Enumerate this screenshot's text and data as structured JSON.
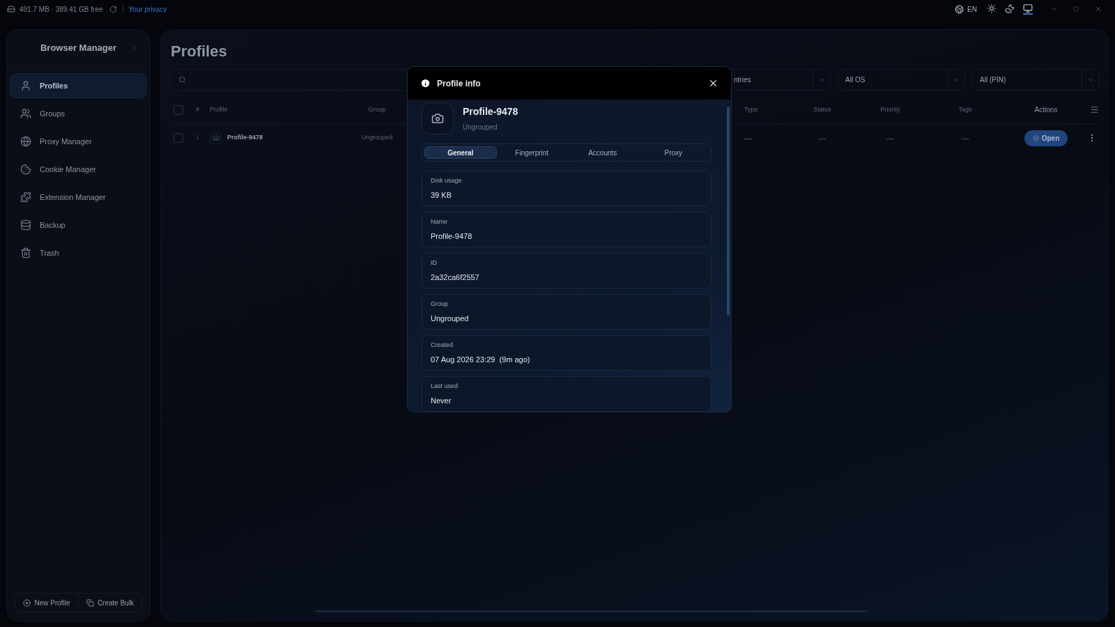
{
  "top_bar": {
    "storage": "491.7 MB · 389.41 GB free",
    "privacy_link": "Your privacy",
    "language": "EN",
    "themes": [
      {
        "kind": "light",
        "selected": false
      },
      {
        "kind": "dark",
        "selected": false
      },
      {
        "kind": "system",
        "selected": true
      }
    ]
  },
  "sidebar": {
    "title": "Browser Manager",
    "items": [
      {
        "label": "Profiles",
        "kind": "user",
        "selected": true
      },
      {
        "label": "Groups",
        "kind": "users",
        "selected": false
      },
      {
        "label": "Proxy Manager",
        "kind": "globe",
        "selected": false
      },
      {
        "label": "Cookie Manager",
        "kind": "cookie",
        "selected": false
      },
      {
        "label": "Extension Manager",
        "kind": "extension",
        "selected": false
      },
      {
        "label": "Backup",
        "kind": "database",
        "selected": false
      },
      {
        "label": "Trash",
        "kind": "trash",
        "selected": false
      }
    ],
    "buttons": [
      {
        "label": "New Profile",
        "kind": "plus"
      },
      {
        "label": "Create Bulk",
        "kind": "bulk"
      }
    ]
  },
  "main": {
    "title": "Profiles",
    "filters": [
      {
        "value": "ntries"
      },
      {
        "value": "All OS"
      },
      {
        "value": "All (PIN)"
      }
    ],
    "table": {
      "header_checked": false,
      "columns": [
        "#",
        "Profile",
        "Group",
        "Type",
        "Status",
        "Priority",
        "Tags",
        "Actions"
      ],
      "rows": [
        {
          "index": "1",
          "profile": "Profile-9478",
          "group": "Ungrouped",
          "type": "—",
          "status": "—",
          "priority": "—",
          "tags": "—",
          "action": "Open",
          "checked": false
        }
      ]
    }
  },
  "dialog": {
    "title": "Profile info",
    "profile_name": "Profile-9478",
    "profile_group": "Ungrouped",
    "tabs": [
      {
        "label": "General",
        "selected": true
      },
      {
        "label": "Fingerprint",
        "selected": false
      },
      {
        "label": "Accounts",
        "selected": false
      },
      {
        "label": "Proxy",
        "selected": false
      }
    ],
    "fields": [
      {
        "label": "Disk usage",
        "value": "39 KB"
      },
      {
        "label": "Name",
        "value": "Profile-9478"
      },
      {
        "label": "ID",
        "value": "2a32ca6f2557"
      },
      {
        "label": "Group",
        "value": "Ungrouped"
      },
      {
        "label": "Created",
        "value": "07 Aug 2026 23:29  (9m ago)"
      },
      {
        "label": "Last used",
        "value": "Never"
      }
    ]
  }
}
